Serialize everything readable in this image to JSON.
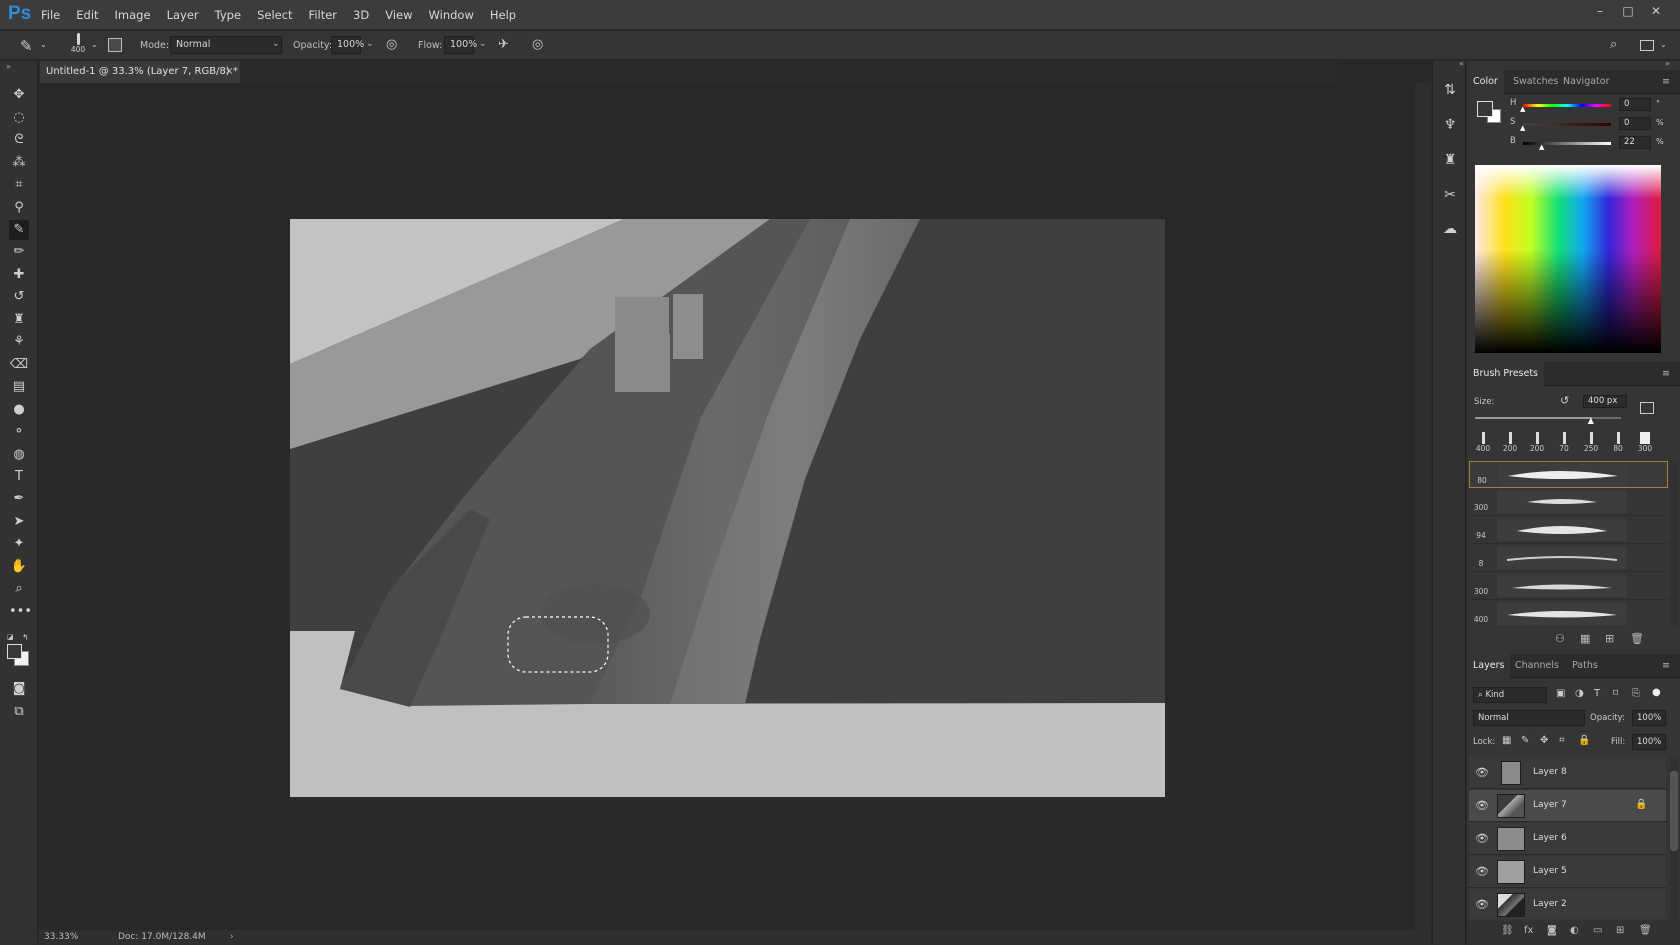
{
  "app": {
    "logo": "Ps",
    "accent": "#2f8cd8"
  },
  "menu": [
    "File",
    "Edit",
    "Image",
    "Layer",
    "Type",
    "Select",
    "Filter",
    "3D",
    "View",
    "Window",
    "Help"
  ],
  "window_controls": {
    "min": "–",
    "max": "□",
    "close": "✕"
  },
  "options": {
    "brush_size": "400",
    "mode_label": "Mode:",
    "mode_value": "Normal",
    "opacity_label": "Opacity:",
    "opacity_value": "100%",
    "flow_label": "Flow:",
    "flow_value": "100%"
  },
  "document": {
    "tab_title": "Untitled-1 @ 33.3% (Layer 7, RGB/8) *",
    "close": "×"
  },
  "status": {
    "zoom": "33.33%",
    "doc": "Doc: 17.0M/128.4M",
    "arrow": "›"
  },
  "color_panel": {
    "tabs": [
      "Color",
      "Swatches",
      "Navigator"
    ],
    "h_label": "H",
    "s_label": "S",
    "b_label": "B",
    "h_value": "0",
    "s_value": "0",
    "b_value": "22",
    "h_unit": "°",
    "s_unit": "%",
    "b_unit": "%"
  },
  "brush_panel": {
    "tab": "Brush Presets",
    "size_label": "Size:",
    "size_value": "400 px",
    "size_fraction": 0.8,
    "presets_top": [
      "400",
      "200",
      "200",
      "70",
      "250",
      "80",
      "300"
    ],
    "presets_list": [
      "80",
      "300",
      "94",
      "8",
      "300",
      "400"
    ]
  },
  "layers_panel": {
    "tabs": [
      "Layers",
      "Channels",
      "Paths"
    ],
    "kind": "Kind",
    "blend": "Normal",
    "opacity_label": "Opacity:",
    "opacity_value": "100%",
    "lock_label": "Lock:",
    "fill_label": "Fill:",
    "fill_value": "100%",
    "layers": [
      {
        "name": "Layer 8",
        "selected": false,
        "locked": false
      },
      {
        "name": "Layer 7",
        "selected": true,
        "locked": true
      },
      {
        "name": "Layer 6",
        "selected": false,
        "locked": false
      },
      {
        "name": "Layer 5",
        "selected": false,
        "locked": false
      },
      {
        "name": "Layer 2",
        "selected": false,
        "locked": false
      }
    ]
  }
}
